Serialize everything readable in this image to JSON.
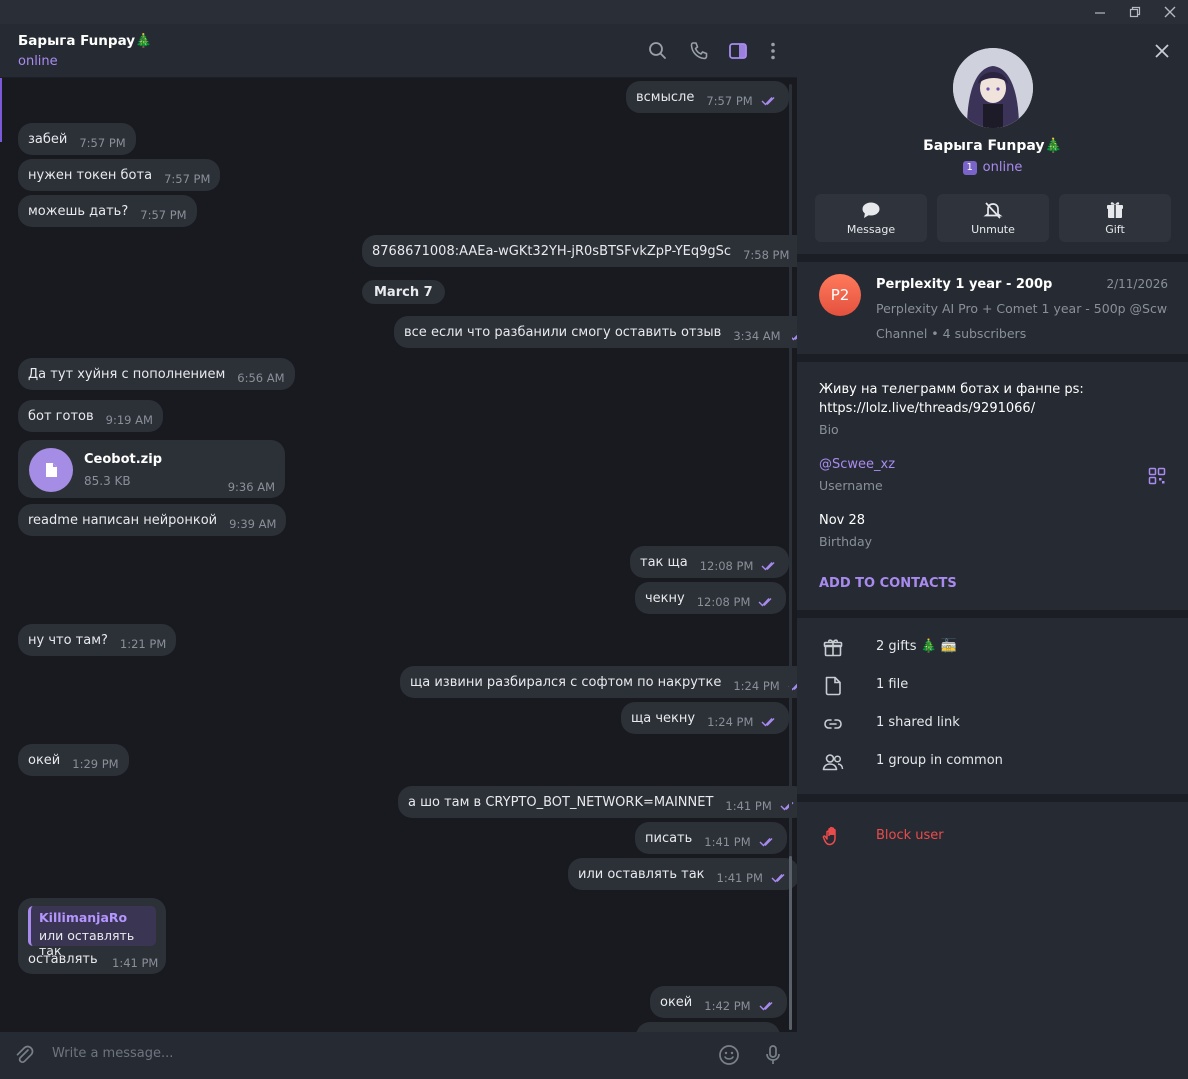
{
  "chat": {
    "title": "Барыга Funpay🎄",
    "status": "online",
    "composer_placeholder": "Write a message...",
    "date_separator": "March 7",
    "messages": [
      {
        "dir": "out",
        "text": "всмысле",
        "time": "7:57 PM"
      },
      {
        "dir": "in",
        "text": "забей",
        "time": "7:57 PM"
      },
      {
        "dir": "in",
        "text": "нужен токен бота",
        "time": "7:57 PM"
      },
      {
        "dir": "in",
        "text": "можешь дать?",
        "time": "7:57 PM"
      },
      {
        "dir": "out",
        "text": "8768671008:AAEa-wGKt32YH-jR0sBTSFvkZpP-YEq9gSc",
        "time": "7:58 PM"
      },
      {
        "dir": "out",
        "text": "все если что разбанили смогу оставить отзыв",
        "time": "3:34 AM"
      },
      {
        "dir": "in",
        "text": "Да тут хуйня с пополнением",
        "time": "6:56 AM"
      },
      {
        "dir": "in",
        "text": "бот готов",
        "time": "9:19 AM"
      },
      {
        "dir": "in",
        "text": "readme написан нейронкой",
        "time": "9:39 AM"
      },
      {
        "dir": "out",
        "text": "так ща",
        "time": "12:08 PM"
      },
      {
        "dir": "out",
        "text": "чекну",
        "time": "12:08 PM"
      },
      {
        "dir": "in",
        "text": "ну что там?",
        "time": "1:21 PM"
      },
      {
        "dir": "out",
        "text": "ща извини разбирался с софтом по накрутке",
        "time": "1:24 PM"
      },
      {
        "dir": "out",
        "text": "ща чекну",
        "time": "1:24 PM"
      },
      {
        "dir": "in",
        "text": "окей",
        "time": "1:29 PM"
      },
      {
        "dir": "out",
        "text": "а шо там в CRYPTO_BOT_NETWORK=MAINNET",
        "time": "1:41 PM"
      },
      {
        "dir": "out",
        "text": "писать",
        "time": "1:41 PM"
      },
      {
        "dir": "out",
        "text": "или оставлять так",
        "time": "1:41 PM"
      },
      {
        "dir": "out",
        "text": "окей",
        "time": "1:42 PM"
      }
    ],
    "file": {
      "name": "Ceobot.zip",
      "size": "85.3 KB",
      "time": "9:36 AM"
    },
    "reply": {
      "author": "KillimanjaRo",
      "quoted": "или оставлять так",
      "text": "оставлять",
      "time": "1:41 PM"
    }
  },
  "profile": {
    "name": "Барыга Funpay🎄",
    "badge": "1",
    "status": "online",
    "actions": [
      {
        "label": "Message",
        "icon": "chat-bubble-icon"
      },
      {
        "label": "Unmute",
        "icon": "bell-off-icon"
      },
      {
        "label": "Gift",
        "icon": "gift-icon"
      }
    ],
    "channel": {
      "initials": "P2",
      "title": "Perplexity 1 year - 200p",
      "date": "2/11/2026",
      "preview": "Perplexity AI Pro + Comet  1 year - 500p  @Scwe...",
      "meta": "Channel • 4 subscribers"
    },
    "bio": {
      "line1": "Живу на телеграмм ботах и фанпе ps:",
      "line2": "https://lolz.live/threads/9291066/",
      "label": "Bio"
    },
    "username": {
      "value": "@Scwee_xz",
      "label": "Username"
    },
    "birthday": {
      "value": "Nov 28",
      "label": "Birthday"
    },
    "add_contacts": "ADD TO CONTACTS",
    "media": [
      {
        "label": "2 gifts 🎄 🚋",
        "icon": "gift-outline-icon"
      },
      {
        "label": "1 file",
        "icon": "file-icon"
      },
      {
        "label": "1 shared link",
        "icon": "link-icon"
      },
      {
        "label": "1 group in common",
        "icon": "group-icon"
      }
    ],
    "block": "Block user"
  },
  "colors": {
    "accent": "#a98bf0",
    "danger": "#ec4b4b",
    "bubble": "#2c3037",
    "panel": "#262b33"
  }
}
